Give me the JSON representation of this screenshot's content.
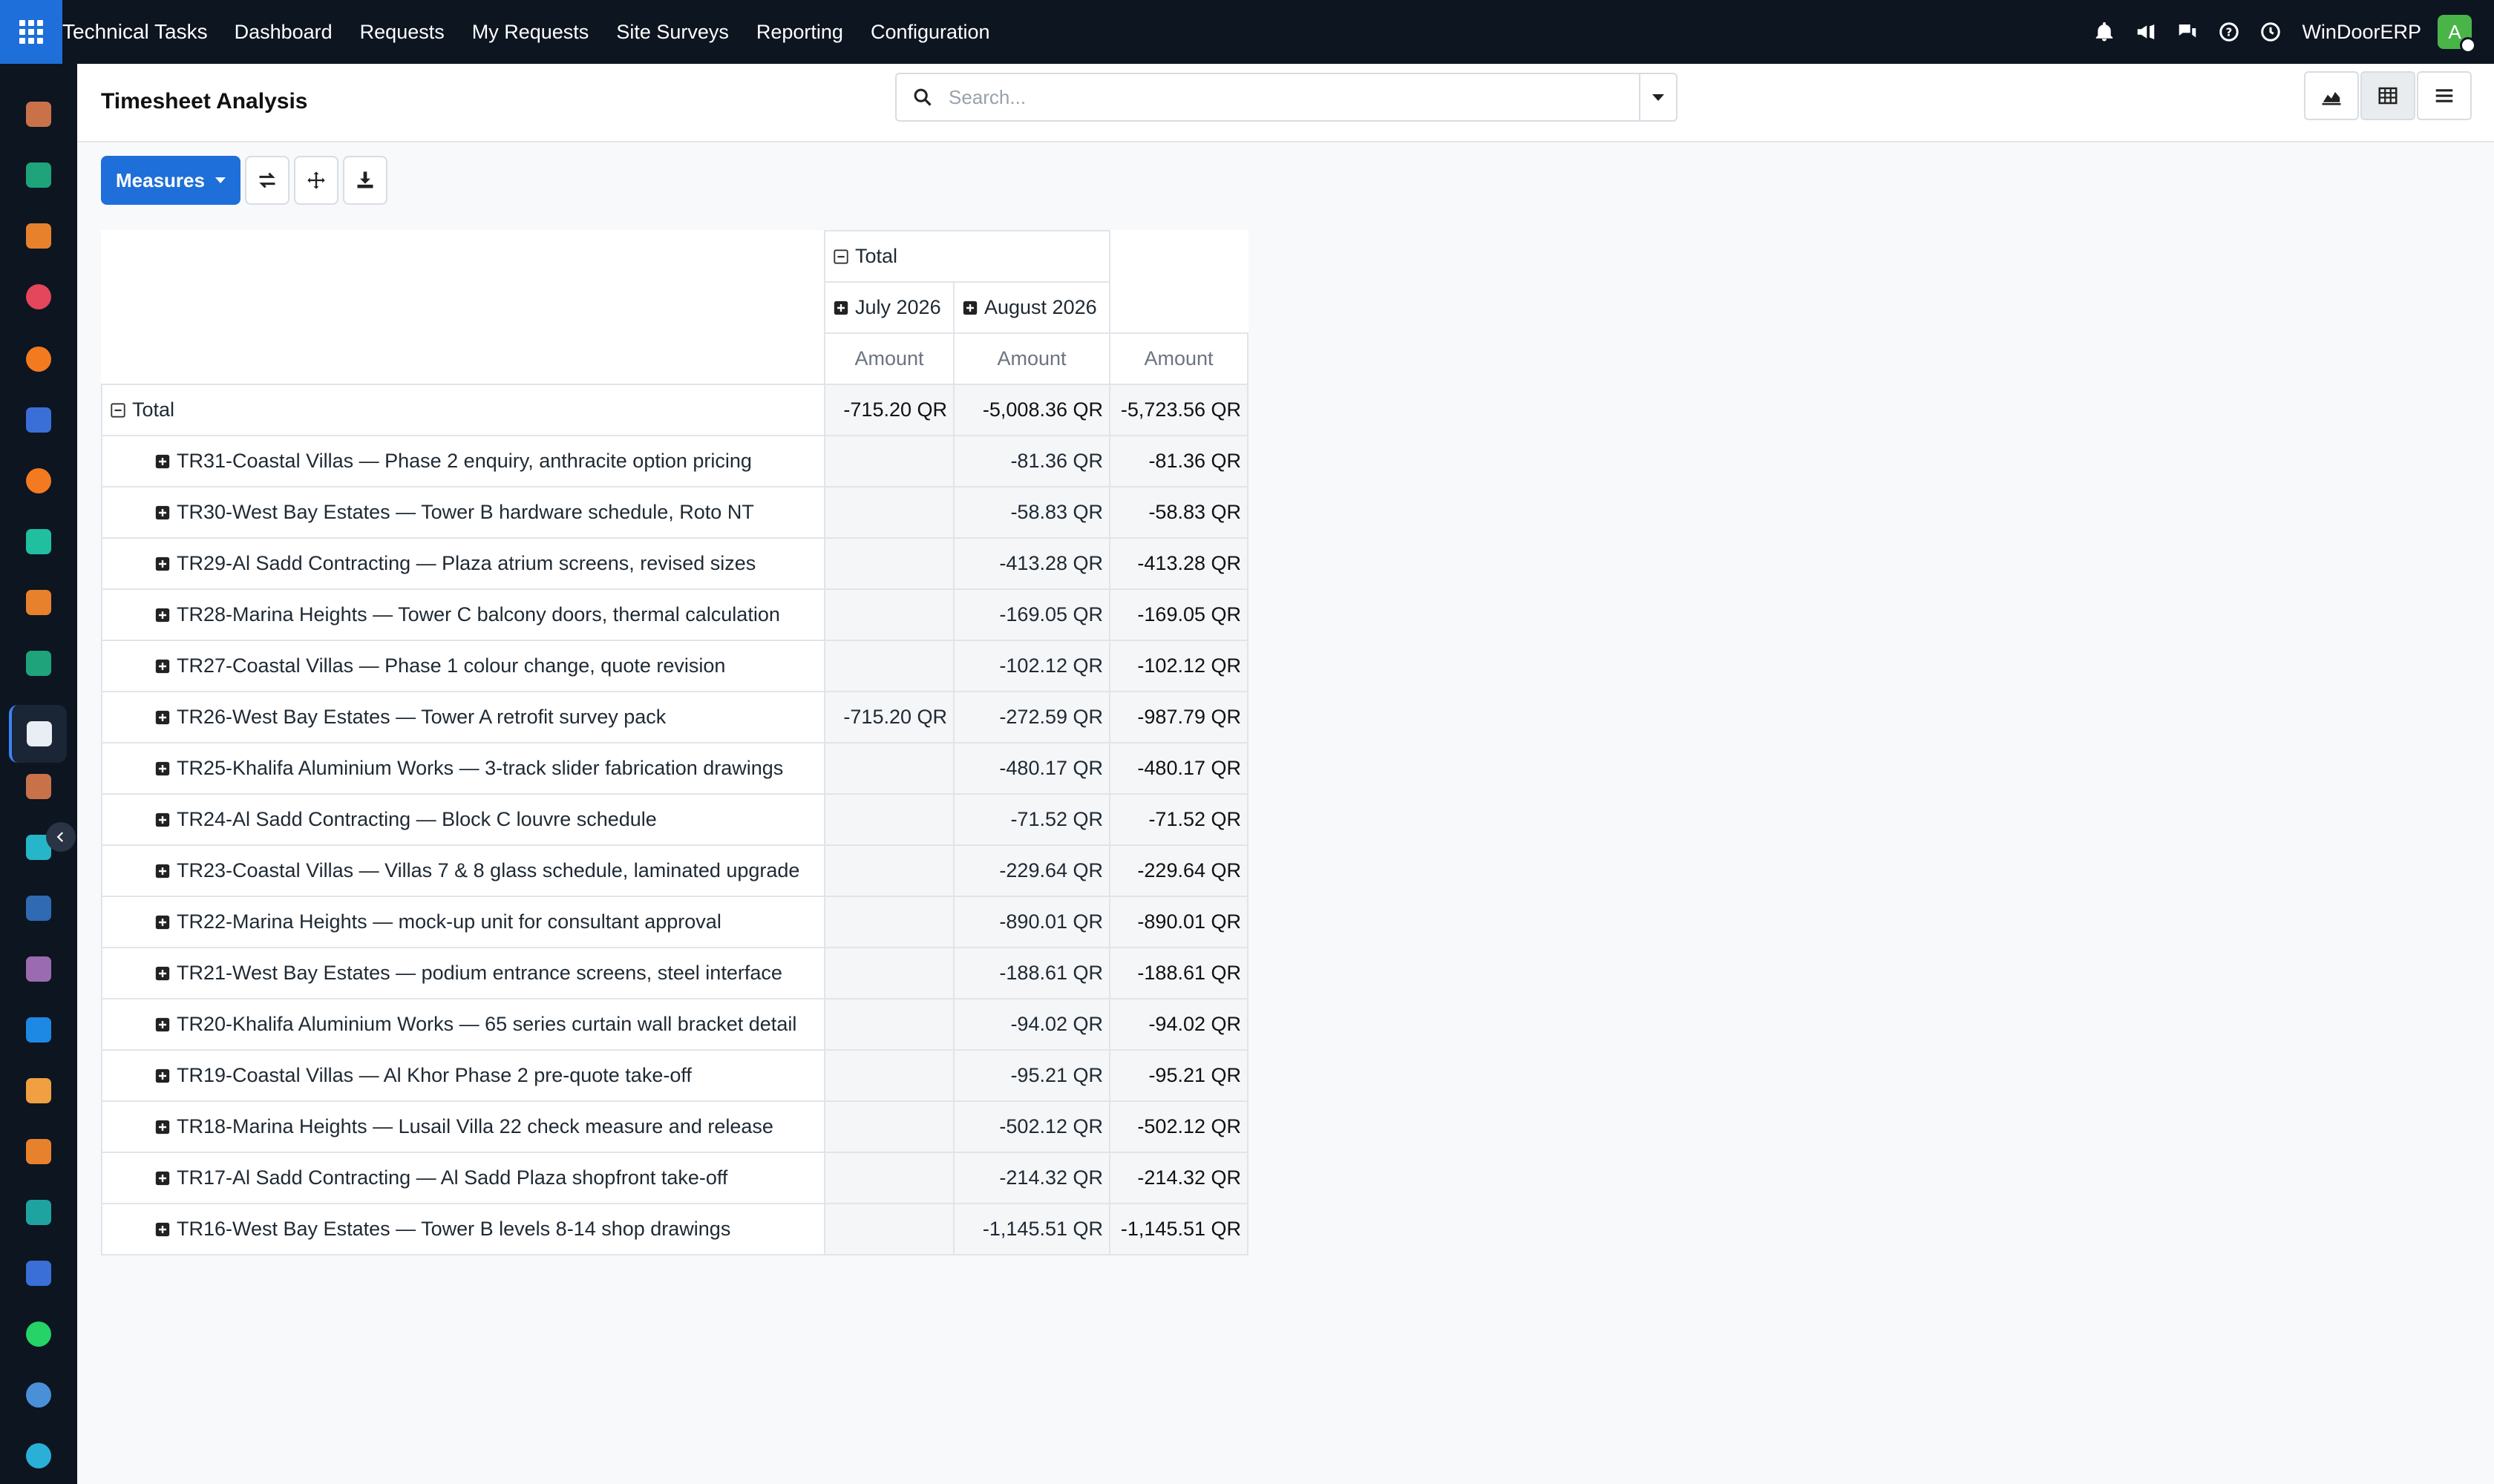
{
  "app": {
    "brand": "Technical Tasks",
    "menu": [
      "Dashboard",
      "Requests",
      "My Requests",
      "Site Surveys",
      "Reporting",
      "Configuration"
    ],
    "company": "WinDoorERP",
    "avatar_letter": "A"
  },
  "control": {
    "title": "Timesheet Analysis",
    "search_placeholder": "Search..."
  },
  "toolbar": {
    "measures_label": "Measures"
  },
  "pivot": {
    "col_group_header": "Total",
    "col_headers": [
      "July 2026",
      "August 2026"
    ],
    "measure_label": "Amount",
    "total_row": {
      "label": "Total",
      "values": [
        "-715.20 QR",
        "-5,008.36 QR",
        "-5,723.56 QR"
      ]
    },
    "rows": [
      {
        "label": "TR31-Coastal Villas — Phase 2 enquiry, anthracite option pricing",
        "values": [
          "",
          "-81.36 QR",
          "-81.36 QR"
        ]
      },
      {
        "label": "TR30-West Bay Estates — Tower B hardware schedule, Roto NT",
        "values": [
          "",
          "-58.83 QR",
          "-58.83 QR"
        ]
      },
      {
        "label": "TR29-Al Sadd Contracting — Plaza atrium screens, revised sizes",
        "values": [
          "",
          "-413.28 QR",
          "-413.28 QR"
        ]
      },
      {
        "label": "TR28-Marina Heights — Tower C balcony doors, thermal calculation",
        "values": [
          "",
          "-169.05 QR",
          "-169.05 QR"
        ]
      },
      {
        "label": "TR27-Coastal Villas — Phase 1 colour change, quote revision",
        "values": [
          "",
          "-102.12 QR",
          "-102.12 QR"
        ]
      },
      {
        "label": "TR26-West Bay Estates — Tower A retrofit survey pack",
        "values": [
          "-715.20 QR",
          "-272.59 QR",
          "-987.79 QR"
        ]
      },
      {
        "label": "TR25-Khalifa Aluminium Works — 3-track slider fabrication drawings",
        "values": [
          "",
          "-480.17 QR",
          "-480.17 QR"
        ]
      },
      {
        "label": "TR24-Al Sadd Contracting — Block C louvre schedule",
        "values": [
          "",
          "-71.52 QR",
          "-71.52 QR"
        ]
      },
      {
        "label": "TR23-Coastal Villas — Villas 7 & 8 glass schedule, laminated upgrade",
        "values": [
          "",
          "-229.64 QR",
          "-229.64 QR"
        ]
      },
      {
        "label": "TR22-Marina Heights — mock-up unit for consultant approval",
        "values": [
          "",
          "-890.01 QR",
          "-890.01 QR"
        ]
      },
      {
        "label": "TR21-West Bay Estates — podium entrance screens, steel interface",
        "values": [
          "",
          "-188.61 QR",
          "-188.61 QR"
        ]
      },
      {
        "label": "TR20-Khalifa Aluminium Works — 65 series curtain wall bracket detail",
        "values": [
          "",
          "-94.02 QR",
          "-94.02 QR"
        ]
      },
      {
        "label": "TR19-Coastal Villas — Al Khor Phase 2 pre-quote take-off",
        "values": [
          "",
          "-95.21 QR",
          "-95.21 QR"
        ]
      },
      {
        "label": "TR18-Marina Heights — Lusail Villa 22 check measure and release",
        "values": [
          "",
          "-502.12 QR",
          "-502.12 QR"
        ]
      },
      {
        "label": "TR17-Al Sadd Contracting — Al Sadd Plaza shopfront take-off",
        "values": [
          "",
          "-214.32 QR",
          "-214.32 QR"
        ]
      },
      {
        "label": "TR16-West Bay Estates — Tower B levels 8-14 shop drawings",
        "values": [
          "",
          "-1,145.51 QR",
          "-1,145.51 QR"
        ]
      }
    ]
  },
  "sidebar_icons": [
    {
      "name": "app-icon-1",
      "color": "#c9724a"
    },
    {
      "name": "app-icon-2",
      "color": "#1fa37a"
    },
    {
      "name": "app-icon-3",
      "color": "#e8812c"
    },
    {
      "name": "app-icon-4",
      "color": "#e4465b"
    },
    {
      "name": "app-icon-5",
      "color": "#f47a20"
    },
    {
      "name": "app-icon-6",
      "color": "#3a6fd8"
    },
    {
      "name": "app-icon-7",
      "color": "#f47a20"
    },
    {
      "name": "app-icon-8",
      "color": "#1fbfa0"
    },
    {
      "name": "app-icon-9",
      "color": "#e8812c"
    },
    {
      "name": "app-icon-10",
      "color": "#1fa37a"
    },
    {
      "name": "app-icon-11",
      "color": "#e9eef5"
    },
    {
      "name": "app-icon-12",
      "color": "#c9724a"
    },
    {
      "name": "app-icon-13",
      "color": "#27b5c9"
    },
    {
      "name": "app-icon-14",
      "color": "#2f6ab3"
    },
    {
      "name": "app-icon-15",
      "color": "#9a6bb0"
    },
    {
      "name": "app-icon-16",
      "color": "#1e88e5"
    },
    {
      "name": "app-icon-17",
      "color": "#f0a040"
    },
    {
      "name": "app-icon-18",
      "color": "#e8812c"
    },
    {
      "name": "app-icon-19",
      "color": "#1fa3a0"
    },
    {
      "name": "app-icon-20",
      "color": "#3a6fd8"
    },
    {
      "name": "app-icon-21",
      "color": "#25d366"
    },
    {
      "name": "app-icon-22",
      "color": "#4a90d9"
    },
    {
      "name": "app-icon-23",
      "color": "#2ab0d6"
    }
  ]
}
